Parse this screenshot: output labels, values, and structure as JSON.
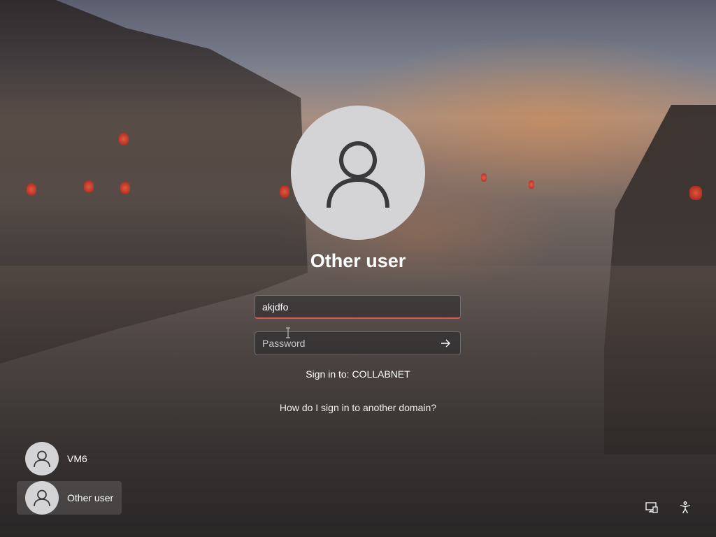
{
  "login": {
    "display_name": "Other user",
    "username_value": "akjdfo",
    "password_placeholder": "Password",
    "sign_in_to": "Sign in to: COLLABNET",
    "other_domain_link": "How do I sign in to another domain?"
  },
  "users": [
    {
      "name": "VM6",
      "selected": false
    },
    {
      "name": "Other user",
      "selected": true
    }
  ],
  "corner_icons": [
    "network-icon",
    "accessibility-icon"
  ],
  "colors": {
    "input_focus_underline": "#e0574a",
    "avatar_bg": "#d4d4d6",
    "avatar_glyph": "#3a3a3a"
  }
}
